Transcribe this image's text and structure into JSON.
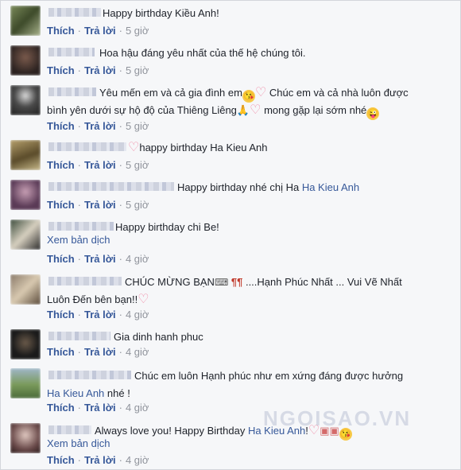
{
  "actions": {
    "like": "Thích",
    "reply": "Trả lời",
    "separator": "·"
  },
  "see_translation": "Xem bản dịch",
  "watermark": "NGOISAO.VN",
  "comments": [
    {
      "text": "Happy birthday Kiều Anh!",
      "time": "5 giờ"
    },
    {
      "text": "Hoa hậu đáng yêu nhất của thế hệ chúng tôi.",
      "time": "5 giờ"
    },
    {
      "text_line1": "Yêu mến em và cả gia đình em",
      "text_line1b": "Chúc em và cả nhà luôn được",
      "text_line2": "bình yên dưới sự hộ độ của Thiêng Liêng",
      "text_line2b": "mong gặp lại sớm nhé",
      "time": "5 giờ"
    },
    {
      "text": "happy birthday Ha Kieu Anh",
      "time": "5 giờ"
    },
    {
      "text": "Happy birthday nhé chị Ha",
      "tag": "Ha Kieu Anh",
      "time": "5 giờ"
    },
    {
      "text": "Happy birthday chi Be!",
      "time": "4 giờ"
    },
    {
      "text_line1": "CHÚC MỪNG BẠN",
      "text_line1b": "....Hạnh Phúc Nhất ... Vui Vẽ Nhất",
      "text_line2": "Luôn Đến bên bạn!!",
      "time": "4 giờ"
    },
    {
      "text": "Gia dinh hanh phuc",
      "time": "4 giờ"
    },
    {
      "text_line1": "Chúc em luôn Hạnh phúc như em xứng đáng được hưởng",
      "tag": "Ha Kieu Anh",
      "text_line2": " nhé !",
      "time": "4 giờ"
    },
    {
      "text": "Always love you! Happy Birthday",
      "tag": "Ha Kieu Anh",
      "text_end": "!",
      "time": "4 giờ"
    }
  ]
}
